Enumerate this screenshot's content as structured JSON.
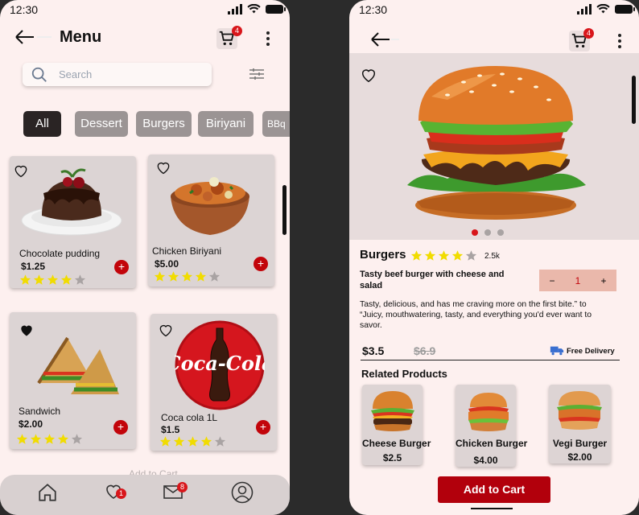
{
  "status": {
    "time_left": "12:30",
    "time_right": "12:30"
  },
  "menu_screen": {
    "title": "Menu",
    "cart_count": "4",
    "search_placeholder": "Search",
    "categories": [
      "All",
      "Dessert",
      "Burgers",
      "Biriyani",
      "BBq"
    ],
    "items": [
      {
        "name": "Chocolate pudding",
        "price": "$1.25",
        "rating": 4,
        "favorite": false
      },
      {
        "name": "Chicken Biriyani",
        "price": "$5.00",
        "rating": 4,
        "favorite": false
      },
      {
        "name": "Sandwich",
        "price": "$2.00",
        "rating": 4,
        "favorite": true
      },
      {
        "name": "Coca cola 1L",
        "price": "$1.5",
        "rating": 4,
        "favorite": false
      }
    ],
    "ghost_text": "Add to Cart",
    "nav": {
      "favorites_badge": "1",
      "messages_badge": "8"
    },
    "coca_cola_logo": "Coca-Cola"
  },
  "detail_screen": {
    "cart_count": "4",
    "product_category": "Burgers",
    "rating": 4,
    "review_count": "2.5k",
    "product_title": "Tasty beef burger with cheese and salad",
    "quantity": "1",
    "qty_minus": "−",
    "qty_plus": "+",
    "description": "Tasty, delicious, and has me craving more on the first bite.” to “Juicy, mouthwatering, tasty, and everything you'd ever want to savor.",
    "price": "$3.5",
    "old_price": "$6.9",
    "delivery": "Free Delivery",
    "related_title": "Related Products",
    "related": [
      {
        "name": "Cheese Burger",
        "price": "$2.5"
      },
      {
        "name": "Chicken Burger",
        "price": "$4.00"
      },
      {
        "name": "Vegi Burger",
        "price": "$2.00"
      }
    ],
    "add_to_cart": "Add to Cart",
    "carousel_active_index": 0
  },
  "colors": {
    "accent_red": "#c2040a",
    "star_yellow": "#f1dc00",
    "chip_active": "#2a2424"
  }
}
